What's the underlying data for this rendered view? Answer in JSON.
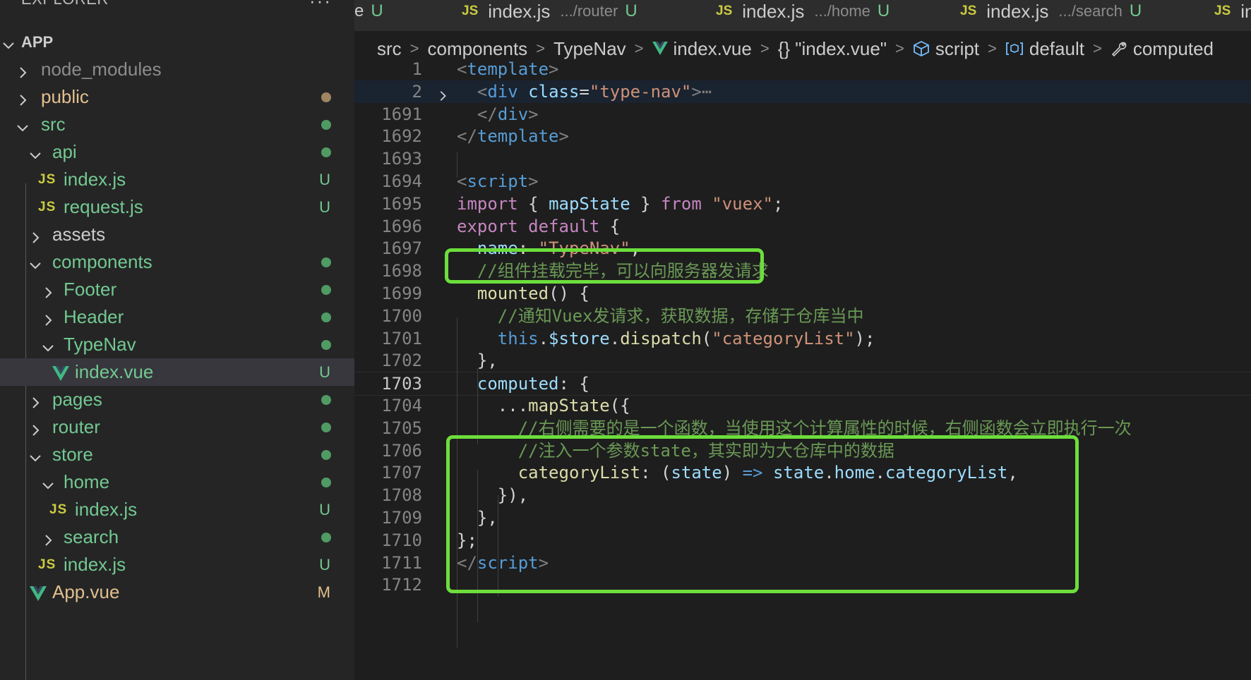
{
  "sidebar": {
    "title": "EXPLORER",
    "more": "···",
    "tree": [
      {
        "label": "APP",
        "status": ""
      },
      {
        "label": "node_modules",
        "status": ""
      },
      {
        "label": "public",
        "status": ""
      },
      {
        "label": "src",
        "status": ""
      },
      {
        "label": "api",
        "status": ""
      },
      {
        "label": "index.js",
        "status": "U"
      },
      {
        "label": "request.js",
        "status": "U"
      },
      {
        "label": "assets",
        "status": ""
      },
      {
        "label": "components",
        "status": ""
      },
      {
        "label": "Footer",
        "status": ""
      },
      {
        "label": "Header",
        "status": ""
      },
      {
        "label": "TypeNav",
        "status": ""
      },
      {
        "label": "index.vue",
        "status": "U"
      },
      {
        "label": "pages",
        "status": ""
      },
      {
        "label": "router",
        "status": ""
      },
      {
        "label": "store",
        "status": ""
      },
      {
        "label": "home",
        "status": ""
      },
      {
        "label": "index.js",
        "status": "U"
      },
      {
        "label": "search",
        "status": ""
      },
      {
        "label": "index.js",
        "status": "U"
      },
      {
        "label": "App.vue",
        "status": "M"
      }
    ],
    "js_badge": "JS"
  },
  "tabs": [
    {
      "label": "",
      "path": "e",
      "status": "U"
    },
    {
      "label": "index.js",
      "path": ".../router",
      "status": "U"
    },
    {
      "label": "index.js",
      "path": ".../home",
      "status": "U"
    },
    {
      "label": "index.js",
      "path": ".../search",
      "status": "U"
    },
    {
      "label": "index",
      "path": "",
      "status": ""
    }
  ],
  "breadcrumb": [
    "src",
    "components",
    "TypeNav",
    "index.vue",
    "{} \"index.vue\"",
    "script",
    "default",
    "computed"
  ],
  "editor": {
    "line_numbers": [
      "1",
      "2",
      "1691",
      "1692",
      "1693",
      "1694",
      "1695",
      "1696",
      "1697",
      "1698",
      "1699",
      "1700",
      "1701",
      "1702",
      "1703",
      "1704",
      "1705",
      "1706",
      "1707",
      "1708",
      "1709",
      "1710",
      "1711",
      "1712"
    ],
    "lines": [
      {
        "t": [
          [
            "t-br",
            "<"
          ],
          [
            "t-tag",
            "template"
          ],
          [
            "t-br",
            ">"
          ]
        ]
      },
      {
        "t": [
          [
            "t-pl",
            "  "
          ],
          [
            "t-br",
            "<"
          ],
          [
            "t-tag",
            "div"
          ],
          [
            "t-pl",
            " "
          ],
          [
            "t-attr",
            "class"
          ],
          [
            "t-pl",
            "="
          ],
          [
            "t-str",
            "\"type-nav\""
          ],
          [
            "t-br",
            ">"
          ],
          [
            "t-ell",
            "⋯"
          ]
        ]
      },
      {
        "t": [
          [
            "t-pl",
            "  "
          ],
          [
            "t-br",
            "</"
          ],
          [
            "t-tag",
            "div"
          ],
          [
            "t-br",
            ">"
          ]
        ]
      },
      {
        "t": [
          [
            "t-br",
            "</"
          ],
          [
            "t-tag",
            "template"
          ],
          [
            "t-br",
            ">"
          ]
        ]
      },
      {
        "t": []
      },
      {
        "t": [
          [
            "t-br",
            "<"
          ],
          [
            "t-tag",
            "script"
          ],
          [
            "t-br",
            ">"
          ]
        ]
      },
      {
        "t": [
          [
            "t-kw",
            "import"
          ],
          [
            "t-pl",
            " { "
          ],
          [
            "t-var",
            "mapState"
          ],
          [
            "t-pl",
            " } "
          ],
          [
            "t-kw",
            "from"
          ],
          [
            "t-pl",
            " "
          ],
          [
            "t-str",
            "\"vuex\""
          ],
          [
            "t-pl",
            ";"
          ]
        ]
      },
      {
        "t": [
          [
            "t-kw",
            "export"
          ],
          [
            "t-pl",
            " "
          ],
          [
            "t-kw",
            "default"
          ],
          [
            "t-pl",
            " {"
          ]
        ]
      },
      {
        "t": [
          [
            "t-pl",
            "  "
          ],
          [
            "t-var",
            "name"
          ],
          [
            "t-pl",
            ": "
          ],
          [
            "t-str",
            "\"TypeNav\""
          ],
          [
            "t-pl",
            ","
          ]
        ]
      },
      {
        "t": [
          [
            "t-pl",
            "  "
          ],
          [
            "t-cm",
            "//组件挂载完毕，可以向服务器发请求"
          ]
        ]
      },
      {
        "t": [
          [
            "t-pl",
            "  "
          ],
          [
            "t-fn",
            "mounted"
          ],
          [
            "t-pl",
            "() {"
          ]
        ]
      },
      {
        "t": [
          [
            "t-pl",
            "    "
          ],
          [
            "t-cm",
            "//通知Vuex发请求，获取数据，存储于仓库当中"
          ]
        ]
      },
      {
        "t": [
          [
            "t-pl",
            "    "
          ],
          [
            "t-kw2",
            "this"
          ],
          [
            "t-pl",
            "."
          ],
          [
            "t-var",
            "$store"
          ],
          [
            "t-pl",
            "."
          ],
          [
            "t-fn",
            "dispatch"
          ],
          [
            "t-pl",
            "("
          ],
          [
            "t-str",
            "\"categoryList\""
          ],
          [
            "t-pl",
            ");"
          ]
        ]
      },
      {
        "t": [
          [
            "t-pl",
            "  },"
          ]
        ]
      },
      {
        "t": [
          [
            "t-pl",
            "  "
          ],
          [
            "t-var",
            "computed"
          ],
          [
            "t-pl",
            ": {"
          ]
        ]
      },
      {
        "t": [
          [
            "t-pl",
            "    ..."
          ],
          [
            "t-fn",
            "mapState"
          ],
          [
            "t-pl",
            "({"
          ]
        ]
      },
      {
        "t": [
          [
            "t-pl",
            "      "
          ],
          [
            "t-cm",
            "//右侧需要的是一个函数，当使用这个计算属性的时候，右侧函数会立即执行一次"
          ]
        ]
      },
      {
        "t": [
          [
            "t-pl",
            "      "
          ],
          [
            "t-cm",
            "//注入一个参数state，其实即为大仓库中的数据"
          ]
        ]
      },
      {
        "t": [
          [
            "t-pl",
            "      "
          ],
          [
            "t-fn",
            "categoryList"
          ],
          [
            "t-pl",
            ": ("
          ],
          [
            "t-var",
            "state"
          ],
          [
            "t-pl",
            ") "
          ],
          [
            "t-kw2",
            "=>"
          ],
          [
            "t-pl",
            " "
          ],
          [
            "t-var",
            "state"
          ],
          [
            "t-pl",
            "."
          ],
          [
            "t-var",
            "home"
          ],
          [
            "t-pl",
            "."
          ],
          [
            "t-var",
            "categoryList"
          ],
          [
            "t-pl",
            ","
          ]
        ]
      },
      {
        "t": [
          [
            "t-pl",
            "    }),"
          ]
        ]
      },
      {
        "t": [
          [
            "t-pl",
            "  },"
          ]
        ]
      },
      {
        "t": [
          [
            "t-pl",
            "};"
          ]
        ]
      },
      {
        "t": [
          [
            "t-br",
            "</"
          ],
          [
            "t-tag",
            "script"
          ],
          [
            "t-br",
            ">"
          ]
        ]
      },
      {
        "t": []
      }
    ]
  },
  "colors": {
    "highlight_box": "#6dde3c",
    "untracked": "#73c991",
    "modified": "#e2c08d"
  }
}
